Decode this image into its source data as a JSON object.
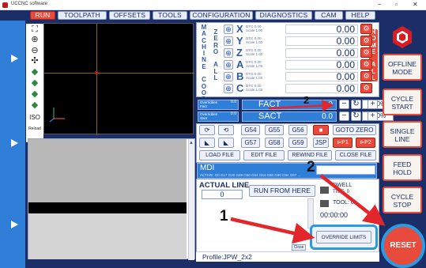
{
  "window": {
    "title": "UCCNC software",
    "controls": [
      "–",
      "▫",
      "✕"
    ]
  },
  "tabs": [
    "RUN",
    "TOOLPATH",
    "OFFSETS",
    "TOOLS",
    "CONFIGURATION",
    "DIAGNOSTICS",
    "CAM",
    "HELP"
  ],
  "active_tab": "RUN",
  "toolbar_labels": {
    "iso": "ISO",
    "reload": "Reload"
  },
  "coords": {
    "machine_label": "MACHINE COORDS",
    "zero_all_label": "ZERO ALL",
    "home_all_label": "HOME ALL",
    "axes": [
      {
        "name": "X",
        "sub1": "DTG 0.00",
        "sub2": "Scale 1.00",
        "value": "0.00"
      },
      {
        "name": "Y",
        "sub1": "DTG 0.00",
        "sub2": "Scale 1.00",
        "value": "0.00"
      },
      {
        "name": "Z",
        "sub1": "DTG 0.00",
        "sub2": "Scale 1.00",
        "value": "0.00"
      },
      {
        "name": "A",
        "sub1": "DTG 0.00",
        "sub2": "Scale 1.00",
        "value": "0.00"
      },
      {
        "name": "B",
        "sub1": "DTG 0.00",
        "sub2": "Scale 1.00",
        "value": "0.00"
      },
      {
        "name": "C",
        "sub1": "DTG 0.00",
        "sub2": "Scale 1.00",
        "value": "0.00"
      }
    ]
  },
  "overrides": {
    "feed": {
      "lbl1": "Overridden",
      "lbl2": "Fact",
      "n1": "0.0",
      "n2": "0.0",
      "name": "FACT",
      "value": "0.0",
      "pct": "100%"
    },
    "spindle": {
      "lbl1": "Overridden",
      "lbl2": "Sset",
      "n1": "0.0",
      "n2": "0.0",
      "name": "SACT",
      "value": "0.0",
      "pct": "100%"
    }
  },
  "buttons": {
    "g54": "G54",
    "g55": "G55",
    "g56": "G56",
    "goto_zero": "GOTO ZERO",
    "g57": "G57",
    "g58": "G58",
    "g59": "G59",
    "jsp": "JSP",
    "p1": "⊳P1",
    "p2": "⊳P2",
    "load_file": "LOAD FILE",
    "edit_file": "EDIT FILE",
    "rewind_file": "REWIND FILE",
    "close_file": "CLOSE FILE"
  },
  "mdi": {
    "label": "MDI",
    "modal": "ACTIVE: G0 G17 G40 G49 G50 G54 G64 G80 G90 G94 G97 ..."
  },
  "actual_line": {
    "label": "ACTUAL LINE",
    "value": "0"
  },
  "run_from_here": "RUN FROM HERE",
  "dwell": {
    "label": "DWELL",
    "sub": "TIME: 0"
  },
  "tool": {
    "label": "TOOL: 0"
  },
  "timer": "00:00:00",
  "override_limits": "OVERRIDE LIMITS",
  "close_small": "Close",
  "profile": "Profile:JPW_2x2",
  "right_buttons": {
    "offline": "OFFLINE MODE",
    "cycle_start": "CYCLE START",
    "single_line": "SINGLE LINE",
    "feed_hold": "FEED HOLD",
    "cycle_stop": "CYCLE STOP",
    "reset": "RESET"
  },
  "annotations": {
    "one": "1",
    "two": "2"
  },
  "colors": {
    "navy": "#1b2e67",
    "accent_red": "#e84b3c",
    "blue": "#2f7ed8",
    "highlight": "#2a9be0"
  }
}
